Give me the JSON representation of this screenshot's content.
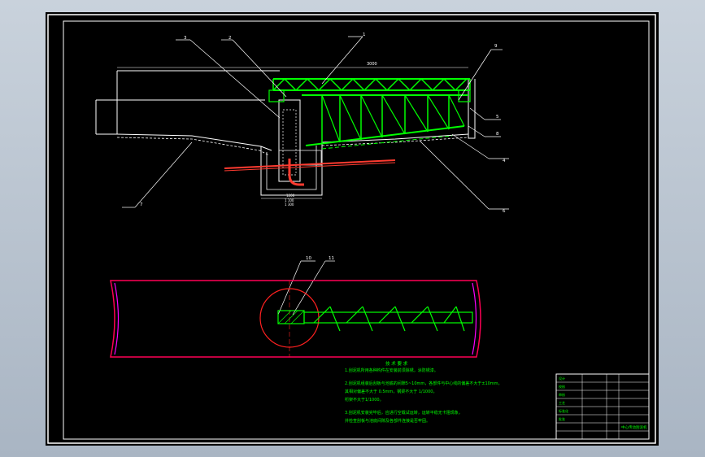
{
  "drawing": {
    "callouts": [
      "1",
      "2",
      "3",
      "4",
      "5",
      "6",
      "7",
      "8",
      "9",
      "10",
      "11"
    ],
    "dim_top": "3000",
    "dim_lower_1": "1200",
    "dim_lower_2": "1 100",
    "dim_lower_3": "1 300",
    "notes_title": "技 术 要 求",
    "notes": [
      "1.刮泥机所用各种构件在安装前须除锈，涂防锈漆。",
      "2.刮泥机组装后刮板与池底的间隙5~10mm，各部件与中心线的偏差不大于±10mm，",
      "  其相对偏差不大于 0.5mm，钢梁不大于 1/1000，",
      "  桁架不大于1/1000。",
      "3.刮泥机安装完毕后，应进行空载试运转，运转平稳无卡阻现象，",
      "  并检查刮板与池底间隙及各部件连接是否牢固。"
    ],
    "title_block": {
      "title": "中心传动刮泥机",
      "labels": [
        "设计",
        "校核",
        "审核",
        "工艺",
        "标准化",
        "批准"
      ]
    }
  },
  "colors": {
    "background": "#000000",
    "frame": "#ffffff",
    "steel": "#00ff00",
    "tank": "#ffffff",
    "plan_outline": "#ff0055",
    "plan_circle": "#ff2020",
    "pipe": "#ff3b30",
    "text": "#00ff00"
  }
}
